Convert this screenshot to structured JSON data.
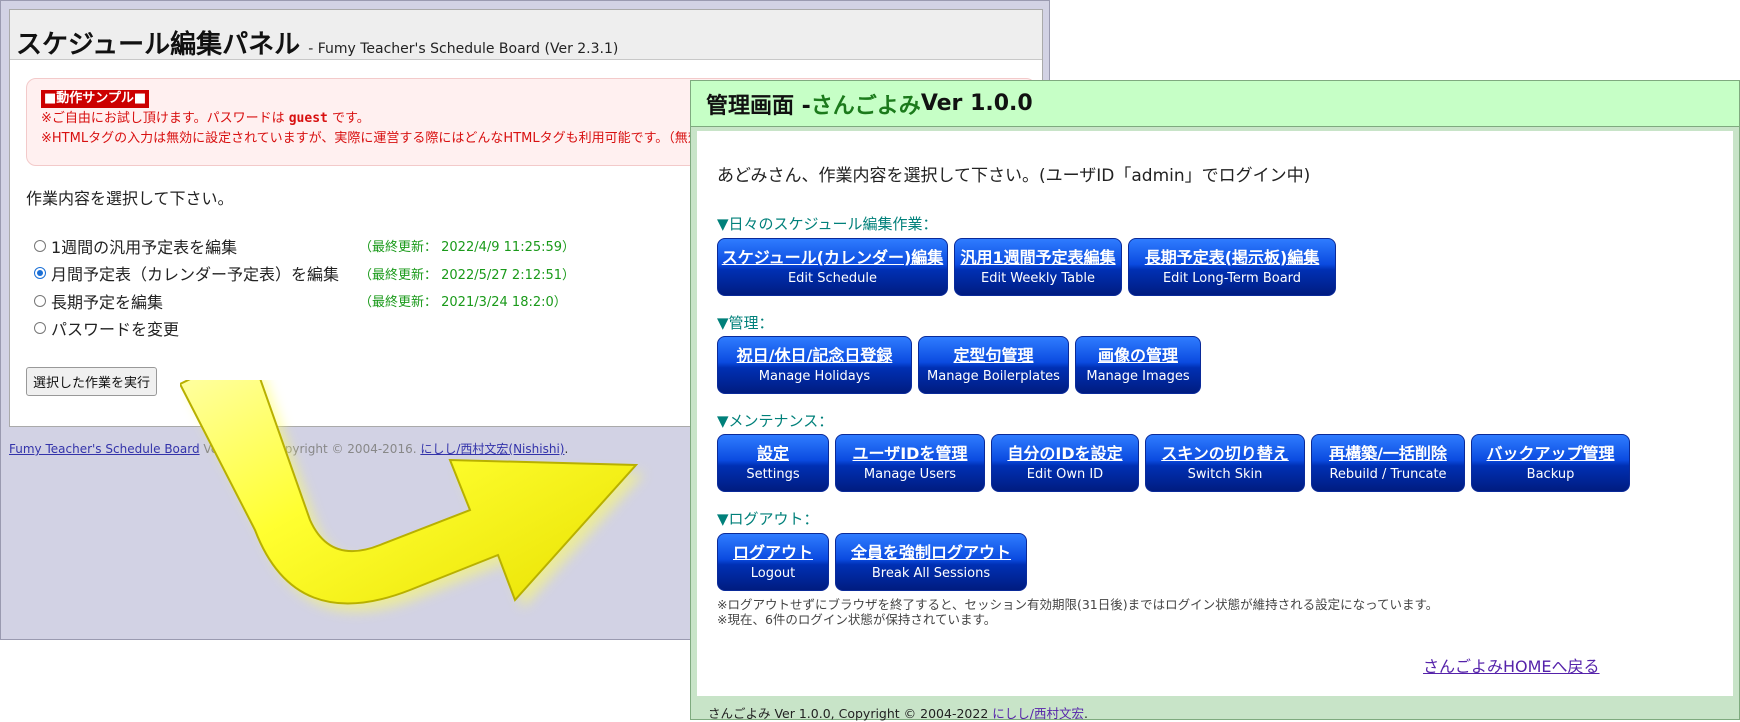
{
  "back": {
    "title": "スケジュール編集パネル",
    "subtitle": "- Fumy Teacher's Schedule Board (Ver 2.3.1)",
    "notice": {
      "tag": "■動作サンプル■",
      "line1_a": "※ご自由にお試し頂けます。パスワードは",
      "line1_code": "guest",
      "line1_b": "です。",
      "line2": "※HTMLタグの入力は無効に設定されていますが、実際に運営する際にはどんなHTMLタグも利用可能です。（無効"
    },
    "prompt": "作業内容を選択して下さい。",
    "options": [
      {
        "label": "1週間の汎用予定表を編集",
        "updated": "（最終更新： 2022/4/9 11:25:59）",
        "selected": false
      },
      {
        "label": "月間予定表（カレンダー予定表）を編集",
        "updated": "（最終更新： 2022/5/27 2:12:51）",
        "selected": true
      },
      {
        "label": "長期予定を編集",
        "updated": "（最終更新： 2021/3/24 18:2:0）",
        "selected": false
      },
      {
        "label": "パスワードを変更",
        "updated": "",
        "selected": false
      }
    ],
    "exec_button": "選択した作業を実行",
    "footer": {
      "link": "Fumy Teacher's Schedule Board",
      "ver": "Ver 2.3.1 : Copyright © 2004-2016.",
      "author": "にしし/西村文宏(Nishishi)",
      "end": "."
    }
  },
  "front": {
    "title_prefix": "管理画面 - ",
    "app_name": "さんごよみ",
    "version": " Ver 1.0.0",
    "welcome": "あどみさん、作業内容を選択して下さい。(ユーザID「admin」でログイン中)",
    "sections": [
      {
        "heading": "▼日々のスケジュール編集作業：",
        "buttons": [
          {
            "jp": "スケジュール(カレンダー)編集",
            "en": "Edit Schedule"
          },
          {
            "jp": "汎用1週間予定表編集",
            "en": "Edit Weekly Table"
          },
          {
            "jp": "長期予定表(掲示板)編集",
            "en": "Edit Long-Term Board"
          }
        ]
      },
      {
        "heading": "▼管理：",
        "buttons": [
          {
            "jp": "祝日/休日/記念日登録",
            "en": "Manage Holidays"
          },
          {
            "jp": "定型句管理",
            "en": "Manage Boilerplates"
          },
          {
            "jp": "画像の管理",
            "en": "Manage Images"
          }
        ]
      },
      {
        "heading": "▼メンテナンス：",
        "buttons": [
          {
            "jp": "設定",
            "en": "Settings"
          },
          {
            "jp": "ユーザIDを管理",
            "en": "Manage Users"
          },
          {
            "jp": "自分のIDを設定",
            "en": "Edit Own ID"
          },
          {
            "jp": "スキンの切り替え",
            "en": "Switch Skin"
          },
          {
            "jp": "再構築/一括削除",
            "en": "Rebuild / Truncate"
          },
          {
            "jp": "バックアップ管理",
            "en": "Backup"
          }
        ]
      },
      {
        "heading": "▼ログアウト：",
        "buttons": [
          {
            "jp": "ログアウト",
            "en": "Logout"
          },
          {
            "jp": "全員を強制ログアウト",
            "en": "Break All Sessions"
          }
        ]
      }
    ],
    "note1": "※ログアウトせずにブラウザを終了すると、セッション有効期限(31日後)まではログイン状態が維持される設定になっています。",
    "note2": "※現在、6件のログイン状態が保持されています。",
    "home_link": "さんごよみHOMEへ戻る",
    "footer_text": "さんごよみ Ver 1.0.0, Copyright © 2004-2022 ",
    "footer_author": "にしし/西村文宏",
    "footer_end": "."
  }
}
